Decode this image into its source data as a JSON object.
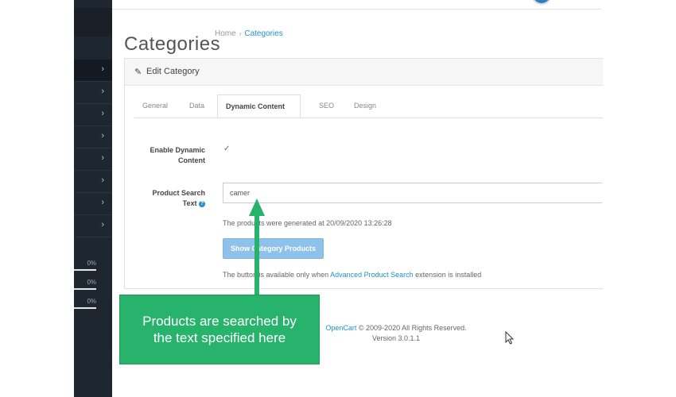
{
  "header": {
    "page_title": "Categories",
    "breadcrumb": {
      "home": "Home",
      "separator": "›",
      "current": "Categories"
    }
  },
  "sidebar": {
    "chevron": "›",
    "stats": [
      "0%",
      "0%",
      "0%"
    ]
  },
  "panel": {
    "title": "Edit Category",
    "tabs": [
      "General",
      "Data",
      "Dynamic Content",
      "SEO",
      "Design"
    ],
    "active_tab": "Dynamic Content"
  },
  "form": {
    "enable_label_line1": "Enable Dynamic",
    "enable_label_line2": "Content",
    "enable_checked_glyph": "✓",
    "search_label_line1": "Product Search",
    "search_label_line2": "Text",
    "help_glyph": "?",
    "search_value": "camer",
    "generated_text": "The products were generated at 20/09/2020 13:26:28",
    "show_button": "Show Category Products",
    "avail_prefix": "The button is available only when ",
    "avail_link": "Advanced Product Search",
    "avail_suffix": " extension is installed"
  },
  "footer": {
    "link": "OpenCart",
    "rights": " © 2009-2020 All Rights Reserved.",
    "version": "Version 3.0.1.1"
  },
  "callout": {
    "line1": "Products are searched by",
    "line2": "the text specified here"
  },
  "colors": {
    "sidebar": "#1e2630",
    "link": "#1e91cf",
    "button": "#8fc2ea",
    "callout": "#27b36b"
  }
}
